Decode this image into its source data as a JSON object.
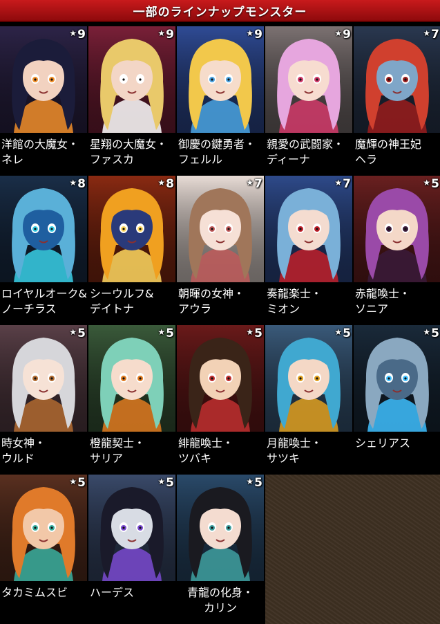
{
  "header": {
    "title": "一部のラインナップモンスター"
  },
  "monsters": [
    {
      "stars": "9",
      "name": "洋館の大魔女・\nネレ",
      "bg": "#2d2448",
      "hair": "#1b1c3a",
      "skin": "#f2d2c0",
      "accent": "#f28f2a"
    },
    {
      "stars": "9",
      "name": "星翔の大魔女・\nファスカ",
      "bg": "#7a2038",
      "hair": "#e9c96a",
      "skin": "#f3d6c6",
      "accent": "#ffffff"
    },
    {
      "stars": "9",
      "name": "御慶の鍵勇者・\nフェルル",
      "bg": "#2f4b95",
      "hair": "#f2c84b",
      "skin": "#f6dccb",
      "accent": "#4aa3e0"
    },
    {
      "stars": "9",
      "name": "親愛の武闘家・\nディーナ",
      "bg": "#7c7272",
      "hair": "#e6a6de",
      "skin": "#f7dcd0",
      "accent": "#d23a6a"
    },
    {
      "stars": "7",
      "name": "魔輝の神王妃\nヘラ",
      "bg": "#2a3850",
      "hair": "#d0402e",
      "skin": "#7fa6c8",
      "accent": "#9a1c1c"
    },
    {
      "stars": "8",
      "name": "ロイヤルオーク&\nノーチラス",
      "bg": "#1a2e48",
      "hair": "#5ab0d8",
      "skin": "#1f5fa0",
      "accent": "#3ad0e8"
    },
    {
      "stars": "8",
      "name": "シーウルフ&\nデイトナ",
      "bg": "#8a2a12",
      "hair": "#f0a020",
      "skin": "#2a3a7a",
      "accent": "#ffd860"
    },
    {
      "stars": "7",
      "name": "朝暉の女神・\nアウラ",
      "bg": "#e8dcd6",
      "hair": "#a0765a",
      "skin": "#f6e0d6",
      "accent": "#c05a5a"
    },
    {
      "stars": "7",
      "name": "奏龍楽士・\nミオン",
      "bg": "#2e4a8a",
      "hair": "#7ab0d8",
      "skin": "#f4dcd0",
      "accent": "#c0202a"
    },
    {
      "stars": "5",
      "name": "赤龍喚士・\nソニア",
      "bg": "#6a2020",
      "hair": "#9a4aa8",
      "skin": "#f4d8c8",
      "accent": "#3a1a3a"
    },
    {
      "stars": "5",
      "name": "時女神・\nウルド",
      "bg": "#5a4048",
      "hair": "#d6d6da",
      "skin": "#f6e2d6",
      "accent": "#b06a30"
    },
    {
      "stars": "5",
      "name": "橙龍契士・\nサリア",
      "bg": "#3a5a3a",
      "hair": "#7ed0b8",
      "skin": "#f6dccc",
      "accent": "#e07a20"
    },
    {
      "stars": "5",
      "name": "緋龍喚士・\nツバキ",
      "bg": "#6a1a1a",
      "hair": "#3a2418",
      "skin": "#f2d2b6",
      "accent": "#c03030"
    },
    {
      "stars": "5",
      "name": "月龍喚士・\nサツキ",
      "bg": "#3a5a7a",
      "hair": "#40a8d0",
      "skin": "#f4d8c6",
      "accent": "#e0a020"
    },
    {
      "stars": "5",
      "name": "シェリアス",
      "bg": "#1a2a3a",
      "hair": "#8aa8c0",
      "skin": "#4a6a88",
      "accent": "#40c0ff"
    },
    {
      "stars": "5",
      "name": "タカミムスビ",
      "bg": "#5a3020",
      "hair": "#e07a2a",
      "skin": "#f2c8a8",
      "accent": "#3ab0a0"
    },
    {
      "stars": "5",
      "name": "ハーデス",
      "bg": "#3a4a6a",
      "hair": "#1a1a2a",
      "skin": "#d8dce4",
      "accent": "#7a4ad0"
    },
    {
      "stars": "5",
      "name": "青龍の化身・\nカリン",
      "bg": "#2a4a6a",
      "hair": "#1a1a20",
      "skin": "#f4dcd0",
      "accent": "#40a0a0"
    }
  ]
}
